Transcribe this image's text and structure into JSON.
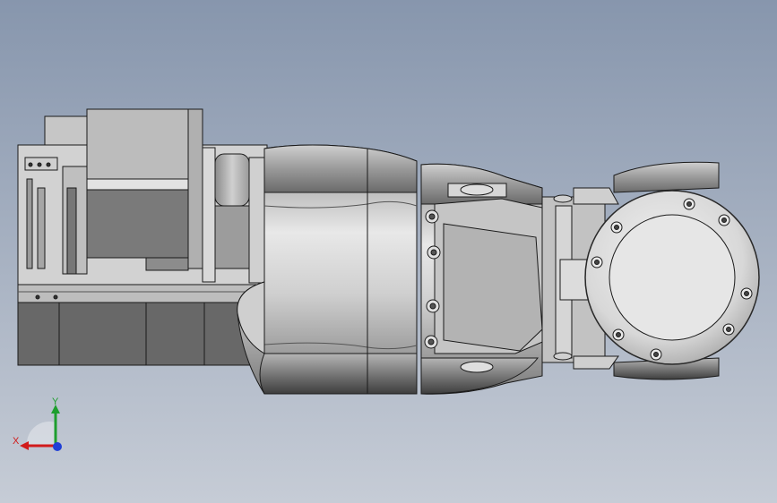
{
  "colors": {
    "background_top": "#8796ad",
    "background_bottom": "#c6ccd6",
    "body_light": "#d9d9d9",
    "body_mid": "#a9a9a9",
    "body_dark": "#6e6e6e",
    "edge": "#1a1a1a",
    "axis_x": "#d11b1b",
    "axis_y": "#1e9e2e",
    "axis_z": "#1f3fd6"
  },
  "triad": {
    "x_label": "X",
    "y_label": "Y",
    "icon": "axis-triad-icon"
  }
}
